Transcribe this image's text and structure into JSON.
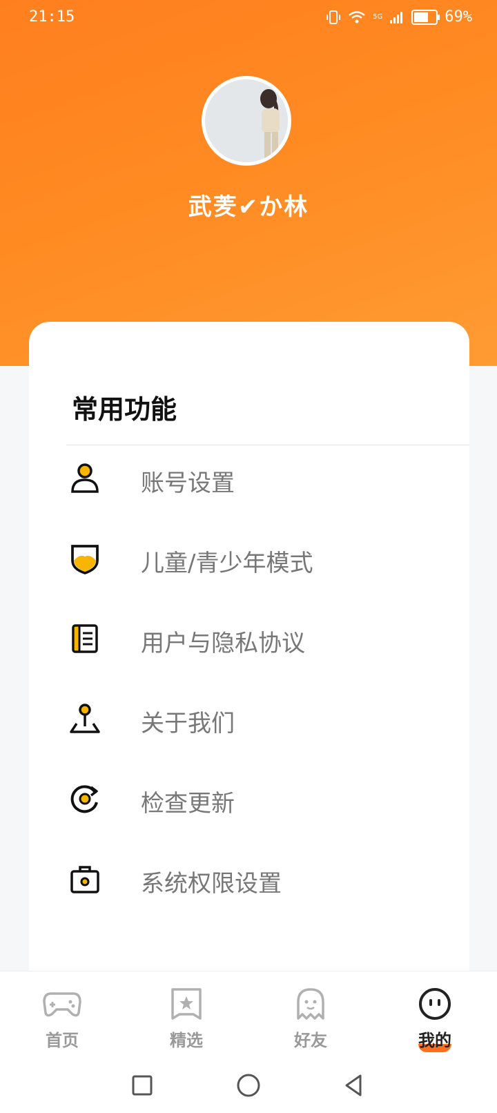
{
  "status_bar": {
    "time": "21:15",
    "network": "5G",
    "battery": "69%",
    "icons": [
      "vibrate-icon",
      "wifi-icon",
      "signal-icon",
      "battery-icon"
    ]
  },
  "profile": {
    "avatar": "avatar-photo",
    "username": "武羐✔か林"
  },
  "section": {
    "title": "常用功能",
    "items": [
      {
        "label": "账号设置",
        "icon": "user-icon"
      },
      {
        "label": "儿童/青少年模式",
        "icon": "shield-icon"
      },
      {
        "label": "用户与隐私协议",
        "icon": "document-icon"
      },
      {
        "label": "关于我们",
        "icon": "location-pin-icon"
      },
      {
        "label": "检查更新",
        "icon": "refresh-icon"
      },
      {
        "label": "系统权限设置",
        "icon": "briefcase-icon"
      }
    ]
  },
  "tabbar": {
    "tabs": [
      {
        "label": "首页",
        "icon": "gamepad-icon",
        "active": false
      },
      {
        "label": "精选",
        "icon": "star-card-icon",
        "active": false
      },
      {
        "label": "好友",
        "icon": "ghost-icon",
        "active": false
      },
      {
        "label": "我的",
        "icon": "face-icon",
        "active": true
      }
    ]
  },
  "nav_bar": {
    "buttons": [
      "recent-apps",
      "home",
      "back"
    ]
  },
  "colors": {
    "accent": "#ff8a22",
    "icon_yellow": "#f7b500",
    "text_gray": "#777777"
  }
}
